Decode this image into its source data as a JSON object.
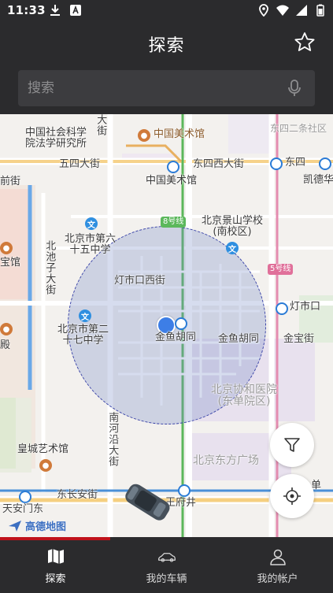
{
  "status_bar": {
    "time": "11:33",
    "left_icons": [
      "download-icon",
      "a-badge-icon"
    ],
    "right_icons": [
      "location-icon",
      "wifi-icon",
      "signal-icon",
      "battery-icon"
    ]
  },
  "header": {
    "title": "探索",
    "favorite_icon": "star-outline-icon"
  },
  "search": {
    "placeholder": "搜索",
    "value": "",
    "mic_icon": "mic-icon"
  },
  "map": {
    "labels": {
      "academy": "中国社会科学院法学研究所",
      "academy_l1": "中国社会科学",
      "academy_l2": "院法学研究所",
      "art_museum_top": "中国美术馆",
      "art_museum": "中国美术馆",
      "wusi": "五四大街",
      "dongsi_west": "东四西大街",
      "dongsi": "东四",
      "dongsi_north_2": "东四二条社区",
      "kaide": "凯德华",
      "qianjie": "前街",
      "baoguan": "宝馆",
      "dian": "殿",
      "school65_l1": "北京市第六",
      "school65_l2": "十五中学",
      "beichizi": "北池子大街",
      "jingshan_l1": "北京景山学校",
      "jingshan_l2": "(南校区)",
      "line8": "8号线",
      "line5": "5号线",
      "dengshikou_west": "灯市口西街",
      "dengshikou": "灯市口",
      "school27_l1": "北京市第二",
      "school27_l2": "十七中学",
      "jinyu_hutong_1": "金鱼胡同",
      "jinyu_hutong_2": "金鱼胡同",
      "jinbao": "金宝街",
      "nanheyan": "南河沿大街",
      "pumc_l1": "北京协和医院",
      "pumc_l2": "(东单院区)",
      "huangcheng_art": "皇城艺术馆",
      "oriental_plaza": "北京东方广场",
      "dongchanganjie": "东长安街",
      "wangfujing": "王府井",
      "tiananmen_east": "天安门东",
      "dan": "单",
      "dadian": "大街"
    },
    "logo_text": "高德地图",
    "filter_icon": "filter-icon",
    "locate_icon": "locate-crosshair-icon"
  },
  "progress": {
    "fraction": 0.33,
    "color": "#c0121a"
  },
  "bottom_nav": {
    "items": [
      {
        "label": "探索",
        "icon": "map-icon",
        "active": true
      },
      {
        "label": "我的车辆",
        "icon": "car-icon",
        "active": false
      },
      {
        "label": "我的帐户",
        "icon": "person-icon",
        "active": false
      }
    ]
  },
  "colors": {
    "background": "#2b2b2d",
    "search_bg": "#3c3c3f",
    "location_dot": "#3d7ee6",
    "radius_fill": "rgba(120,140,200,0.30)",
    "progress": "#c0121a"
  }
}
